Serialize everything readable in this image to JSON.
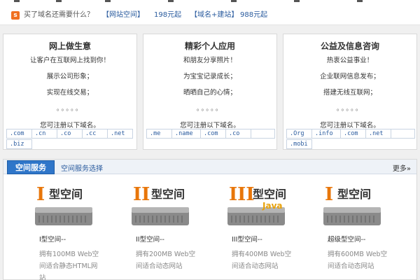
{
  "topbar": {
    "icon": "s",
    "question": "买了域名还需要什么？",
    "items": [
      {
        "label": "【网站空间】",
        "price": "198元起"
      },
      {
        "label": "【域名+建站】",
        "price": "988元起"
      }
    ]
  },
  "boxes": [
    {
      "title": "网上做生意",
      "lines": [
        "让客户在互联网上找到你！",
        "展示公司形象；",
        "实现在线交易；"
      ],
      "dots": "。。。。。",
      "note": "您可注册以下域名。",
      "tlds": [
        ".com",
        ".cn",
        ".co",
        ".cc",
        ".net",
        ".biz"
      ]
    },
    {
      "title": "精彩个人应用",
      "lines": [
        "和朋友分享照片！",
        "为宝宝记录成长；",
        "晒晒自己的心情；"
      ],
      "dots": "。。。。。",
      "note": "您可注册以下域名。",
      "tlds": [
        ".me",
        ".name",
        ".com",
        ".co"
      ]
    },
    {
      "title": "公益及信息咨询",
      "lines": [
        "热衷公益事业！",
        "企业联网信息发布；",
        "搭建无线互联网；"
      ],
      "dots": "。。。。。",
      "note": "您可注册以下域名。",
      "tlds": [
        ".Org",
        ".info",
        ".com",
        ".net",
        ".mobi"
      ]
    }
  ],
  "service": {
    "tab_active": "空间服务",
    "tab_sub": "空间服务选择",
    "more": "更多»",
    "products": [
      {
        "numeral": "I",
        "logo_text": "型空间",
        "badge": "",
        "name": "I型空间--",
        "desc": "拥有100MB Web空间适合静态HTML网站"
      },
      {
        "numeral": "II",
        "logo_text": "型空间",
        "badge": "",
        "name": "II型空间--",
        "desc": "拥有200MB Web空间适合动态网站"
      },
      {
        "numeral": "III",
        "logo_text": "型空间",
        "badge": "Java",
        "name": "III型空间--",
        "desc": "拥有400MB Web空间适合动态网站"
      },
      {
        "numeral": "I",
        "logo_text": "型空间",
        "badge": "",
        "name": "超级型空间--",
        "desc": "拥有600MB Web空间适合动态网站"
      }
    ]
  },
  "colors": {
    "accent": "#f07020",
    "link": "#2a5b9e",
    "tab": "#2f76c9"
  }
}
